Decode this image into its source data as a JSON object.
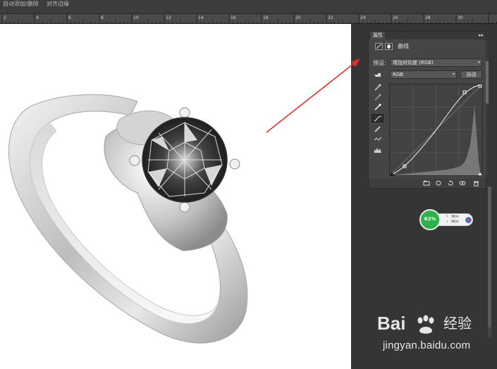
{
  "top_bar": {
    "option_1": "自动添加/删除",
    "option_2": "对齐边缘"
  },
  "ruler": {
    "ticks": [
      "2",
      "4",
      "6",
      "8",
      "10",
      "12",
      "14",
      "16",
      "18",
      "20",
      "22",
      "24",
      "26",
      "28",
      "30"
    ]
  },
  "properties_panel": {
    "tab_label": "属性",
    "tab_controls": "▸▸",
    "adjustment_title": "曲线",
    "preset_label": "预设:",
    "preset_value": "增加对比度 (RGB)",
    "channel_value": "RGB",
    "auto_button": "自动"
  },
  "speed_widget": {
    "percent": "62%",
    "upload": "0K/s",
    "download": "0K/s",
    "accent": "#2db14a"
  },
  "watermark": {
    "brand": "Bai",
    "brand_tail": "经验",
    "url": "jingyan.baidu.com"
  },
  "colors": {
    "arrow": "#e0302a",
    "panel_bg": "#454545",
    "canvas_bg": "#ffffff"
  }
}
